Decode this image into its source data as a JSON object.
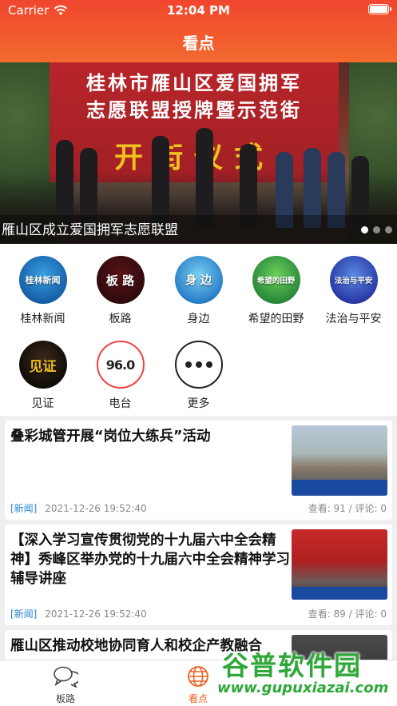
{
  "status_bar": {
    "carrier": "Carrier",
    "time": "12:04 PM"
  },
  "nav": {
    "title": "看点"
  },
  "banner": {
    "board_line1": "桂林市雁山区爱国拥军",
    "board_line2": "志愿联盟授牌暨示范街",
    "board_big": "开街仪式",
    "caption": "雁山区成立爱国拥军志愿联盟",
    "page_count": 3,
    "active_page": 1
  },
  "channels": [
    {
      "label": "桂林新闻",
      "icon_text": "桂林新闻",
      "icon": "guilin-news-logo"
    },
    {
      "label": "板路",
      "icon_text": "板 路",
      "icon": "banlu-logo"
    },
    {
      "label": "身边",
      "icon_text": "身 边",
      "icon": "shenbian-logo"
    },
    {
      "label": "希望的田野",
      "icon_text": "希望的田野",
      "icon": "xiwang-logo"
    },
    {
      "label": "法治与平安",
      "icon_text": "法治与平安",
      "icon": "fazhi-logo"
    },
    {
      "label": "见证",
      "icon_text": "见证",
      "icon": "jianzheng-logo"
    },
    {
      "label": "电台",
      "icon_text": "96.0",
      "icon": "radio-logo"
    },
    {
      "label": "更多",
      "icon_text": "",
      "icon": "more-icon"
    }
  ],
  "news": [
    {
      "title": "叠彩城管开展“岗位大练兵”活动",
      "tag": "[新闻]",
      "time": "2021-12-26 19:52:40",
      "views": "查看: 91",
      "comments": "评论: 0"
    },
    {
      "title": "【深入学习宣传贯彻党的十九届六中全会精神】秀峰区举办党的十九届六中全会精神学习辅导讲座",
      "tag": "[新闻]",
      "time": "2021-12-26 19:52:40",
      "views": "查看: 89",
      "comments": "评论: 0"
    },
    {
      "title": "雁山区推动校地协同育人和校企产教融合"
    }
  ],
  "tabbar": [
    {
      "label": "板路",
      "icon": "chat-bubbles-icon",
      "active": false
    },
    {
      "label": "看点",
      "icon": "globe-icon",
      "active": true
    }
  ],
  "watermark": {
    "main": "谷普软件园",
    "url": "www.gupuxiazai.com"
  },
  "colors": {
    "header": "#f0462e",
    "accent": "#f06020",
    "tag": "#2a8ad0"
  }
}
